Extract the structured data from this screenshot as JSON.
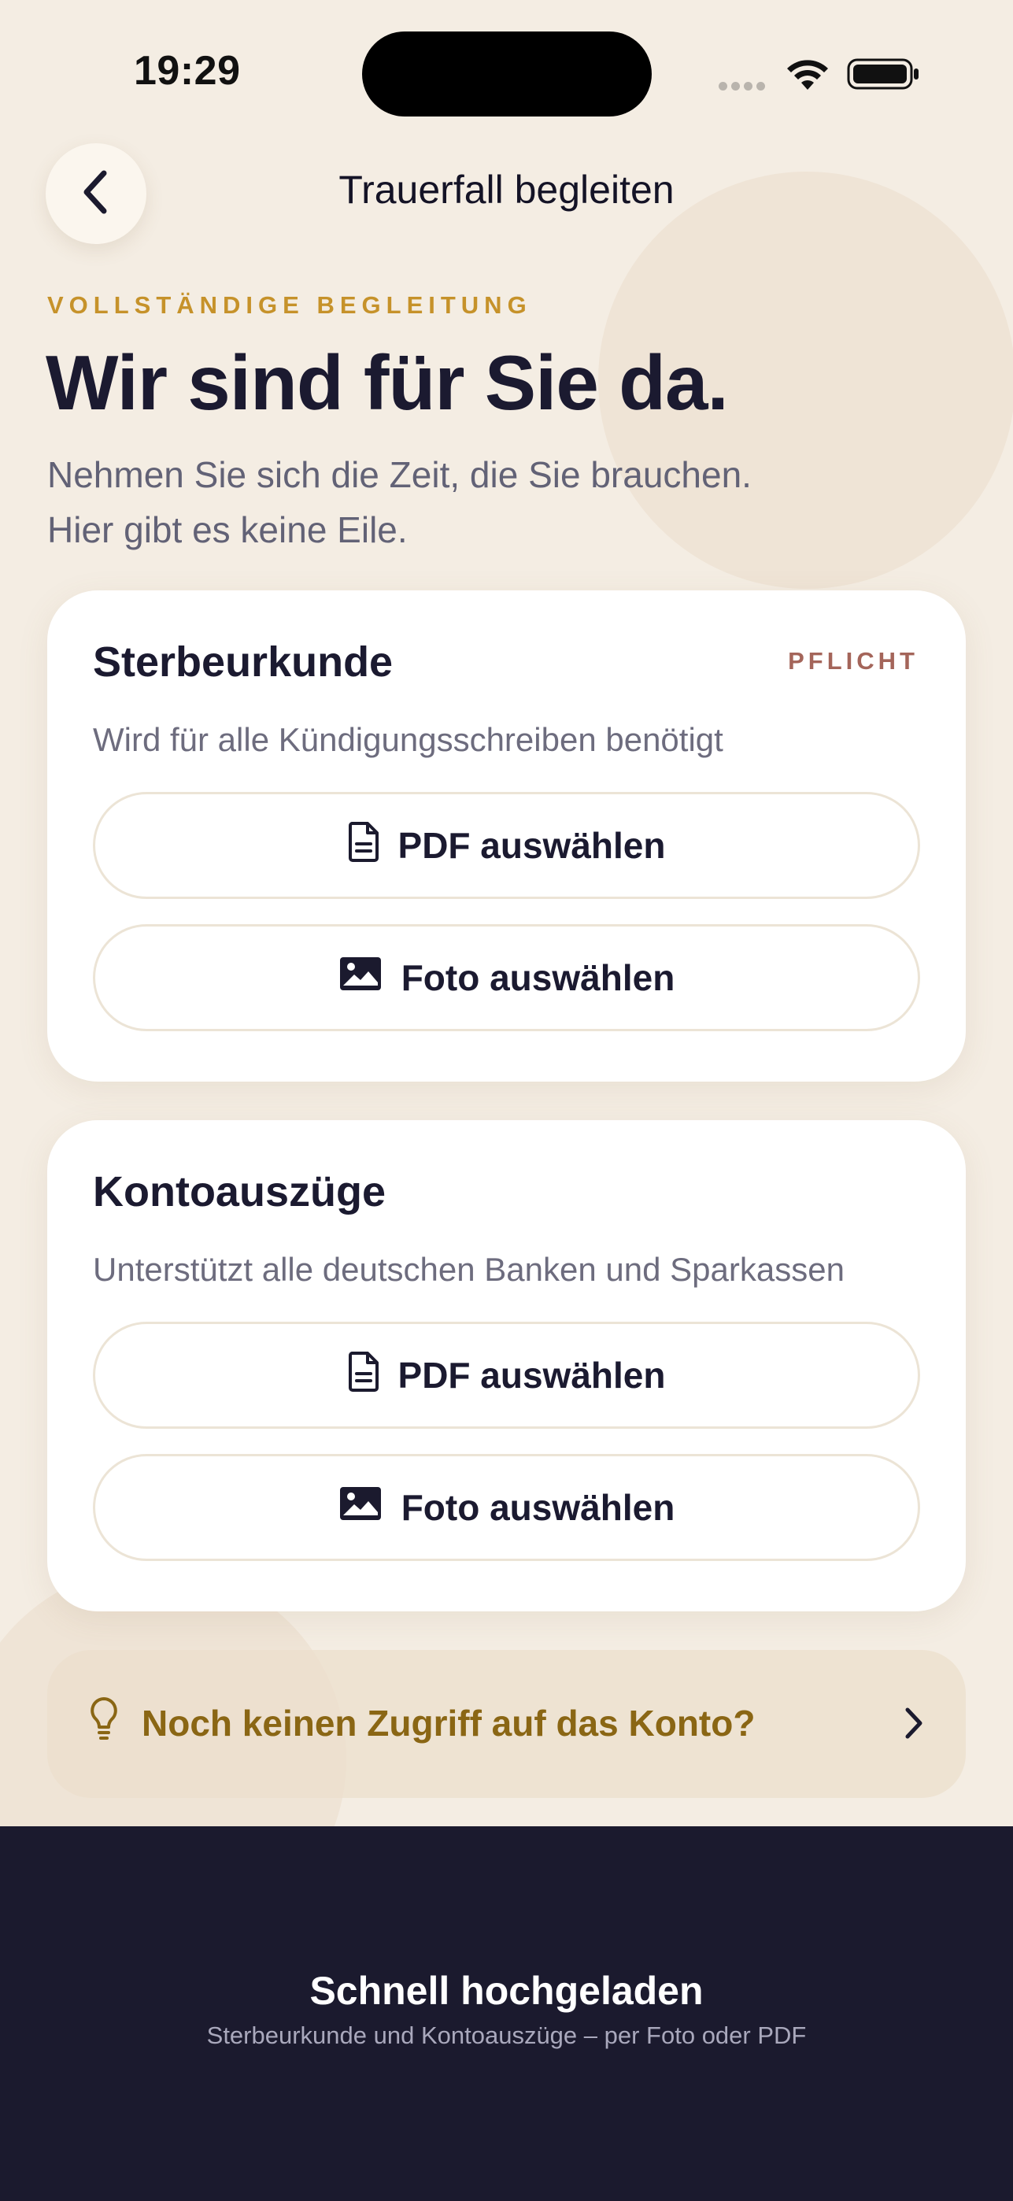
{
  "status_bar": {
    "time": "19:29",
    "icons": [
      "cellular-signal-icon",
      "wifi-icon",
      "battery-icon"
    ]
  },
  "header": {
    "title": "Trauerfall begleiten",
    "back_icon": "chevron-left-icon"
  },
  "intro": {
    "eyebrow": "VOLLSTÄNDIGE BEGLEITUNG",
    "headline": "Wir sind für Sie da.",
    "subline_1": "Nehmen Sie sich die Zeit, die Sie brauchen.",
    "subline_2": "Hier gibt es keine Eile."
  },
  "cards": [
    {
      "title": "Sterbeurkunde",
      "badge": "PFLICHT",
      "description": "Wird für alle Kündigungsschreiben benötigt",
      "pdf_label": "PDF auswählen",
      "photo_label": "Foto auswählen"
    },
    {
      "title": "Kontoauszüge",
      "description": "Unterstützt alle deutschen Banken und Sparkassen",
      "pdf_label": "PDF auswählen",
      "photo_label": "Foto auswählen"
    }
  ],
  "hint": {
    "text": "Noch keinen Zugriff auf das Konto?",
    "icon": "lightbulb-icon"
  },
  "footer": {
    "title": "Schnell hochgeladen",
    "subtitle": "Sterbeurkunde und Kontoauszüge – per Foto oder PDF"
  },
  "colors": {
    "background": "#f4ede3",
    "accent_gold": "#c6922a",
    "badge": "#a4655a",
    "dark": "#1b1a2e",
    "hint_text": "#8a6614"
  }
}
